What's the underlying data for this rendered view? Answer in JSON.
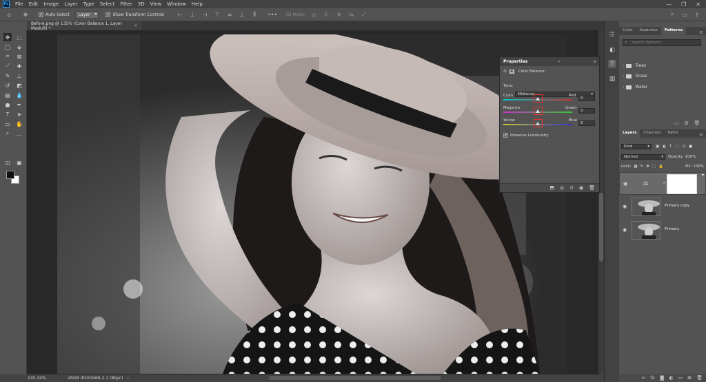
{
  "menubar": {
    "app_icon": "Ps",
    "items": [
      "File",
      "Edit",
      "Image",
      "Layer",
      "Type",
      "Select",
      "Filter",
      "3D",
      "View",
      "Window",
      "Help"
    ],
    "window_controls": [
      "—",
      "❐",
      "✕"
    ]
  },
  "options_bar": {
    "auto_select_label": "Auto-Select",
    "auto_select_target": "Layer",
    "show_transform_label": "Show Transform Controls",
    "mode_label": "3D Mode:"
  },
  "document": {
    "tab_title": "Before.png @ 135% (Color Balance 1, Layer Mask/8) *",
    "close_glyph": "×"
  },
  "status": {
    "zoom": "135.34%",
    "profile": "sRGB IEC61966-2.1 (8bpc)"
  },
  "properties": {
    "title": "Properties",
    "adjustment": "Color Balance",
    "tone_label": "Tone:",
    "tone_value": "Midtones",
    "sliders": [
      {
        "left": "Cyan",
        "right": "Red",
        "value": "0"
      },
      {
        "left": "Magenta",
        "right": "Green",
        "value": "0"
      },
      {
        "left": "Yellow",
        "right": "Blue",
        "value": "0"
      }
    ],
    "preserve_label": "Preserve Luminosity",
    "preserve_checked": true
  },
  "panel_top": {
    "tabs": [
      "Color",
      "Swatches",
      "Patterns"
    ],
    "active_tab": "Patterns",
    "search_placeholder": "Search Patterns",
    "folders": [
      "Trees",
      "Grass",
      "Water"
    ]
  },
  "layers_panel": {
    "tabs": [
      "Layers",
      "Channels",
      "Paths"
    ],
    "filter_label": "Kind",
    "blend_mode": "Normal",
    "opacity_label": "Opacity:",
    "opacity_value": "100%",
    "lock_label": "Lock:",
    "fill_label": "Fill:",
    "fill_value": "100%",
    "layers": [
      {
        "name": "",
        "type": "adjustment"
      },
      {
        "name": "Primary copy",
        "type": "image"
      },
      {
        "name": "Primary",
        "type": "image"
      }
    ]
  },
  "colors": {
    "accent": "#31a8ff",
    "highlight": "#ee3333"
  }
}
